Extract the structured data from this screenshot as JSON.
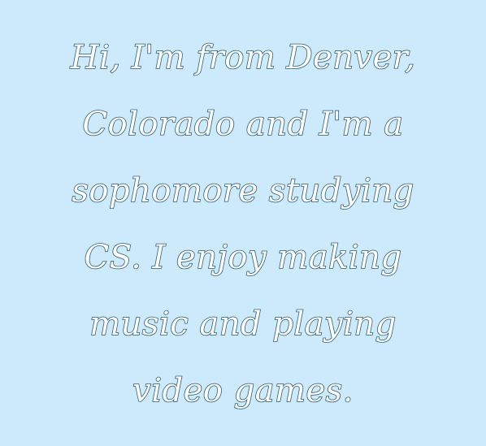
{
  "background_color": "#cdeafd",
  "text_fill_color": "#ffffff",
  "text_outline_color": "#2f5f73",
  "bio": {
    "lines": [
      "Hi, I'm from Denver,",
      "Colorado and I'm a",
      "sophomore studying",
      "CS. I enjoy making",
      "music and playing",
      "video games."
    ]
  }
}
